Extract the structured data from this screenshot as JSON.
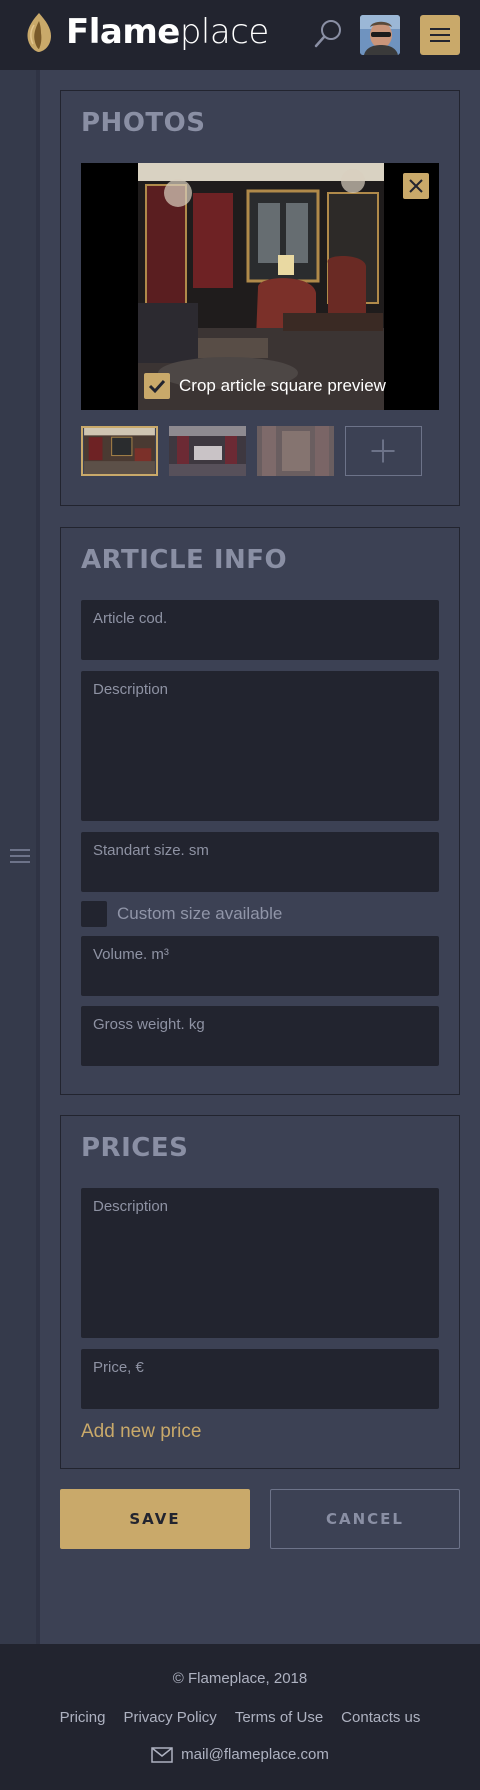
{
  "header": {
    "logo_bold": "Flame",
    "logo_light": "place",
    "icons": {
      "search": "search-icon",
      "menu": "hamburger-icon",
      "avatar": "user-avatar"
    }
  },
  "photos": {
    "title": "PHOTOS",
    "crop_label": "Crop article square preview",
    "crop_checked": true,
    "thumbnail_count": 3
  },
  "article_info": {
    "title": "ARTICLE INFO",
    "article_code_placeholder": "Article cod.",
    "description_placeholder": "Description",
    "standard_size_placeholder": "Standart size. sm",
    "custom_size_label": "Custom size available",
    "custom_size_checked": false,
    "volume_placeholder": "Volume. m³",
    "gross_weight_placeholder": "Gross weight. kg"
  },
  "prices": {
    "title": "PRICES",
    "description_placeholder": "Description",
    "price_placeholder": "Price, €",
    "add_price_label": "Add new price"
  },
  "actions": {
    "save_label": "SAVE",
    "cancel_label": "CANCEL"
  },
  "footer": {
    "copyright": "© Flameplace, 2018",
    "links": [
      "Pricing",
      "Privacy Policy",
      "Terms of Use",
      "Contacts us"
    ],
    "email": "mail@flameplace.com"
  },
  "colors": {
    "accent": "#c9a96a",
    "header_bg": "#22242f",
    "page_bg": "#3c4154",
    "field_bg": "#22242f"
  }
}
